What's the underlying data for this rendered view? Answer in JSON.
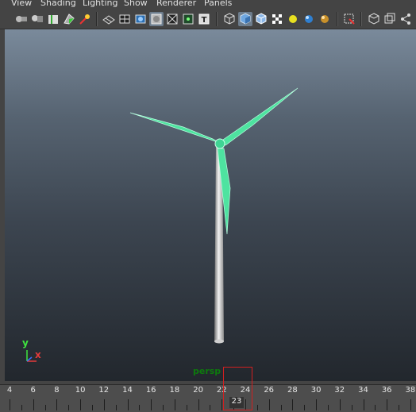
{
  "menu": {
    "items": [
      "View",
      "Shading",
      "Lighting",
      "Show",
      "Renderer",
      "Panels"
    ]
  },
  "toolbar": {
    "icons": [
      "select-camera-icon",
      "camera-attributes-icon",
      "bookmark-icon",
      "image-plane-icon",
      "two-d-pan-zoom-icon",
      "wireframe-icon",
      "grid-icon",
      "film-gate-icon",
      "resolution-gate-icon",
      "gate-mask-icon",
      "field-chart-icon",
      "safe-title-icon",
      "wireframe-cube-icon",
      "smooth-shade-icon",
      "wireframe-on-shaded-icon",
      "textured-icon",
      "use-default-light-icon",
      "shadows-icon",
      "ambient-occlusion-icon",
      "isolate-select-icon",
      "xray-icon",
      "xray-joints-icon",
      "xray-active-icon"
    ]
  },
  "viewport": {
    "camera_label": "persp",
    "axis_y": "y",
    "axis_x": "x"
  },
  "timeslider": {
    "tick_labels": [
      "4",
      "6",
      "8",
      "10",
      "12",
      "14",
      "16",
      "18",
      "20",
      "22",
      "24",
      "26",
      "28",
      "30",
      "32",
      "34",
      "36",
      "38"
    ],
    "current_frame": "23"
  },
  "colors": {
    "blade": "#4ee3a0",
    "tower": "#d8d8d8",
    "current_frame_marker": "#d22020"
  }
}
